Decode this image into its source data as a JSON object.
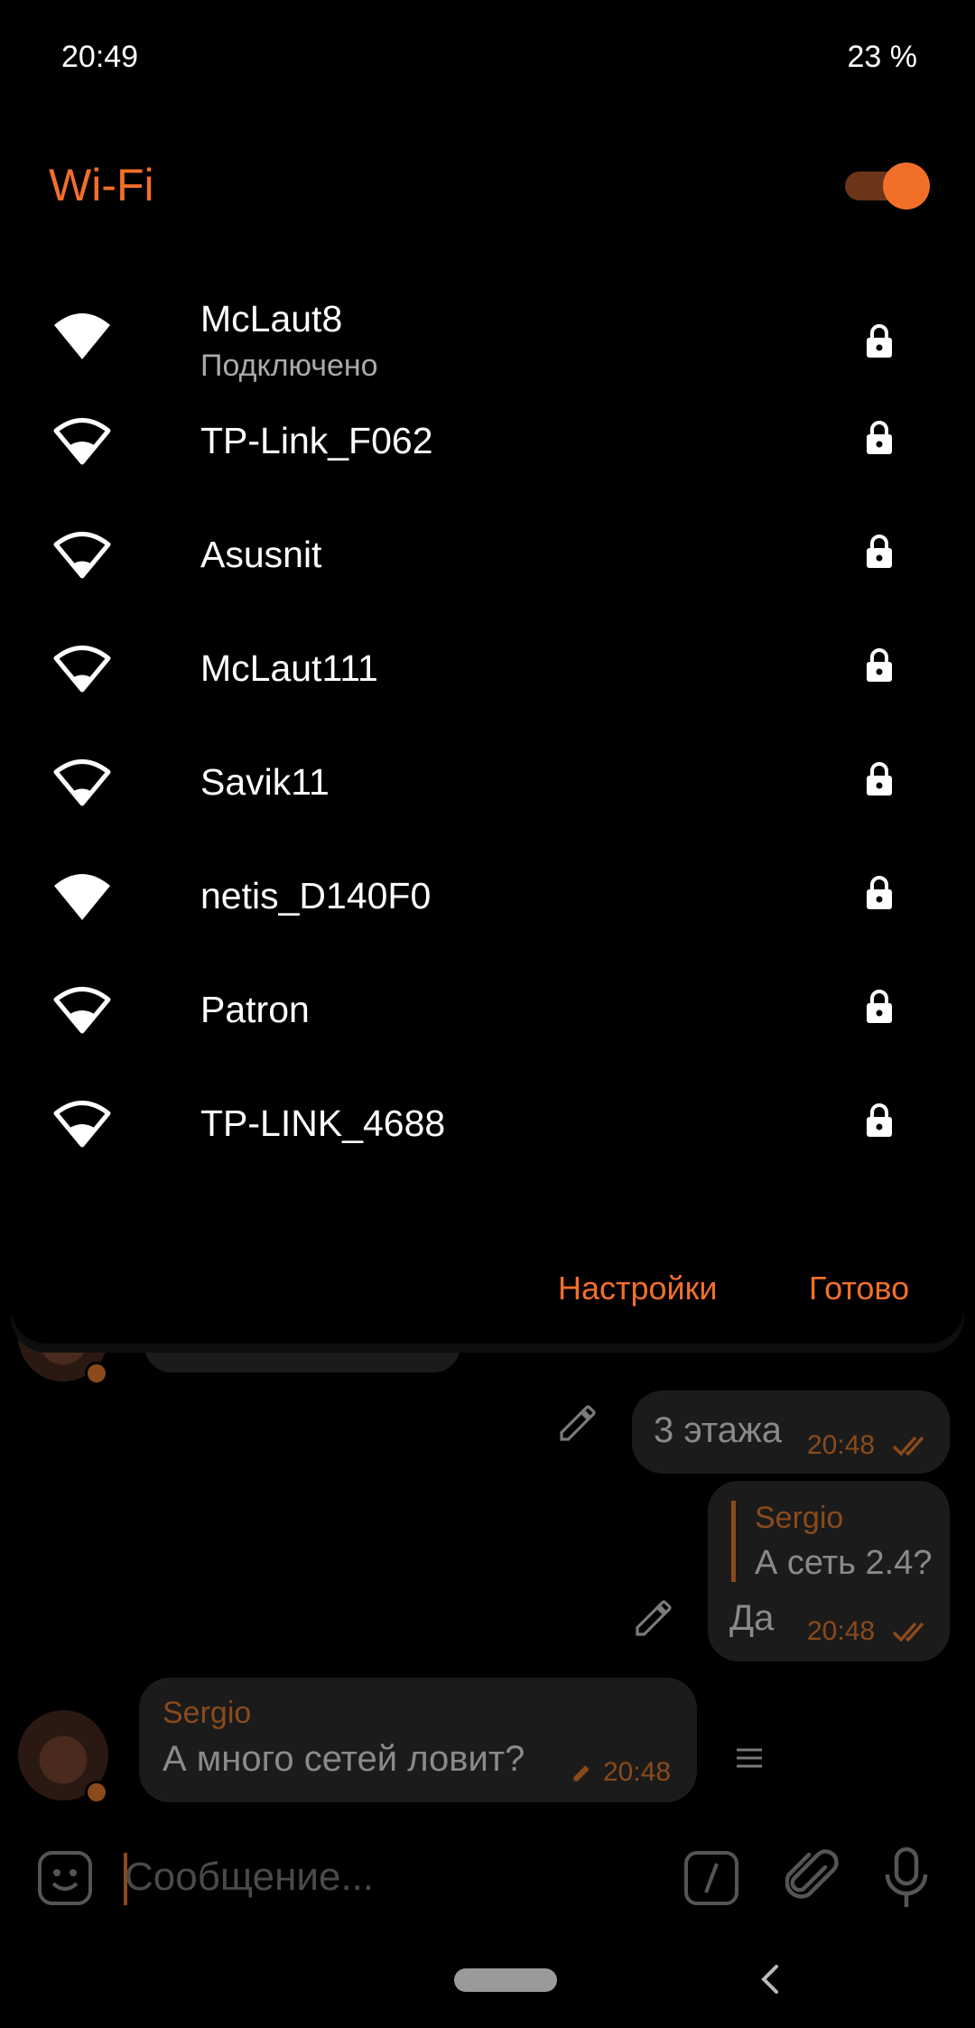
{
  "status": {
    "time": "20:49",
    "battery": "23 %"
  },
  "wifi": {
    "title": "Wi-Fi",
    "enabled": true,
    "accent": "#f26f2a",
    "networks": [
      {
        "name": "McLaut8",
        "status": "Подключено",
        "signal": "full",
        "secured": true
      },
      {
        "name": "TP-Link_F062",
        "signal": "strong",
        "secured": true
      },
      {
        "name": "Asusnit",
        "signal": "medium",
        "secured": true
      },
      {
        "name": "McLaut111",
        "signal": "medium",
        "secured": true
      },
      {
        "name": "Savik11",
        "signal": "medium",
        "secured": true
      },
      {
        "name": "netis_D140F0",
        "signal": "full",
        "secured": true
      },
      {
        "name": "Patron",
        "signal": "strong",
        "secured": true
      },
      {
        "name": "TP-LINK_4688",
        "signal": "strong",
        "secured": true
      }
    ],
    "settings_label": "Настройки",
    "done_label": "Готово"
  },
  "chat": {
    "messages": [
      {
        "text": "3 этажа",
        "time": "20:48",
        "outgoing": true
      },
      {
        "reply_name": "Sergio",
        "reply_text": "А сеть 2.4?",
        "text": "Да",
        "time": "20:48",
        "outgoing": true
      },
      {
        "sender": "Sergio",
        "text": "А много сетей ловит?",
        "time": "20:48",
        "edited": true,
        "outgoing": false
      }
    ],
    "composer_placeholder": "Сообщение..."
  }
}
